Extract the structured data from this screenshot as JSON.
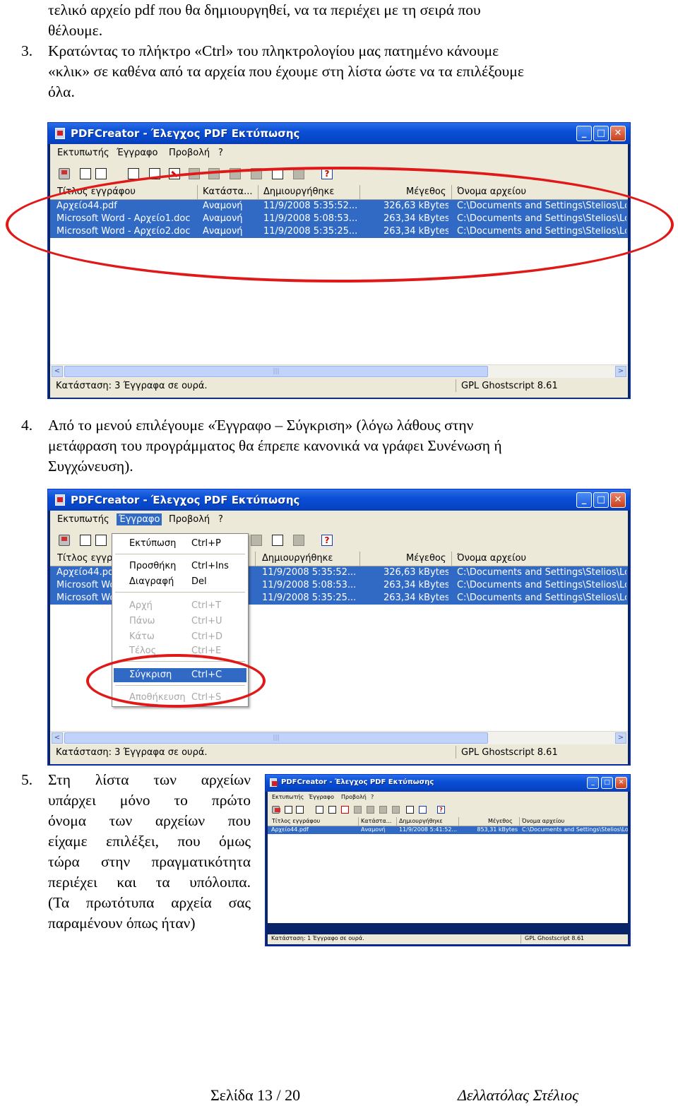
{
  "paragraphs": {
    "top_1": "τελικό αρχείο pdf που θα δημιουργηθεί, να τα περιέχει με τη σειρά που",
    "top_2": "θέλουμε.",
    "step3_num": "3.",
    "step3_1": "Κρατώντας το πλήκτρο «Ctrl» του πληκτρολογίου μας πατημένο κάνουμε",
    "step3_2": "«κλικ» σε καθένα από τα αρχεία που έχουμε στη λίστα ώστε να τα επιλέξουμε",
    "step3_3": "όλα.",
    "step4_num": "4.",
    "step4_1": "Από το μενού επιλέγουμε «Έγγραφο – Σύγκριση» (λόγω λάθους στην",
    "step4_2": "μετάφραση του προγράμματος θα έπρεπε κανονικά να γράφει Συνένωση ή",
    "step4_3": "Συγχώνευση).",
    "step5_num": "5.",
    "step5_lines": [
      "Στη λίστα των αρχείων",
      "υπάρχει μόνο το πρώτο",
      "όνομα των αρχείων που",
      "είχαμε επιλέξει, που όμως",
      "τώρα στην πραγματικότητα",
      "περιέχει και τα υπόλοιπα.",
      "(Τα πρωτότυπα αρχεία σας",
      "παραμένουν όπως ήταν)"
    ]
  },
  "window": {
    "title": "PDFCreator - Έλεγχος PDF Εκτύπωσης",
    "minimize_symbol": "_",
    "maximize_symbol": "□",
    "close_symbol": "✕",
    "menu": [
      "Εκτυπωτής",
      "Έγγραφο",
      "Προβολή",
      "?"
    ],
    "columns": [
      "Τίτλος εγγράφου",
      "Κατάστα...",
      "Δημιουργήθηκε",
      "Μέγεθος",
      "Όνομα αρχείου"
    ],
    "scroll_left": "<",
    "scroll_right": ">",
    "scroll_grip": "|||",
    "help_symbol": "?"
  },
  "screenshot1": {
    "rows": [
      [
        "Αρχείο44.pdf",
        "Αναμονή",
        "11/9/2008 5:35:52...",
        "326,63 kBytes",
        "C:\\Documents and Settings\\Stelios\\Loc"
      ],
      [
        "Microsoft Word - Αρχείο1.doc",
        "Αναμονή",
        "11/9/2008 5:08:53...",
        "263,34 kBytes",
        "C:\\Documents and Settings\\Stelios\\Loc"
      ],
      [
        "Microsoft Word - Αρχείο2.doc",
        "Αναμονή",
        "11/9/2008 5:35:25...",
        "263,34 kBytes",
        "C:\\Documents and Settings\\Stelios\\Loc"
      ]
    ],
    "status_left": "Κατάσταση: 3 Έγγραφα σε ουρά.",
    "status_right": "GPL Ghostscript 8.61"
  },
  "screenshot2": {
    "rows": [
      [
        "Αρχείο44.pd",
        "11/9/2008 5:35:52...",
        "326,63 kBytes",
        "C:\\Documents and Settings\\Stelios\\Loc"
      ],
      [
        "Microsoft Wo",
        "11/9/2008 5:08:53...",
        "263,34 kBytes",
        "C:\\Documents and Settings\\Stelios\\Loc"
      ],
      [
        "Microsoft Wo",
        "11/9/2008 5:35:25...",
        "263,34 kBytes",
        "C:\\Documents and Settings\\Stelios\\Loc"
      ]
    ],
    "col_title_truncated": "Τίτλος εγγρ",
    "menu_items": [
      {
        "label": "Εκτύπωση",
        "shortcut": "Ctrl+P"
      },
      {
        "label": "Προσθήκη",
        "shortcut": "Ctrl+Ins"
      },
      {
        "label": "Διαγραφή",
        "shortcut": "Del"
      },
      {
        "label": "Αρχή",
        "shortcut": "Ctrl+T"
      },
      {
        "label": "Πάνω",
        "shortcut": "Ctrl+U"
      },
      {
        "label": "Κάτω",
        "shortcut": "Ctrl+D"
      },
      {
        "label": "Τέλος",
        "shortcut": "Ctrl+E"
      },
      {
        "label": "Σύγκριση",
        "shortcut": "Ctrl+C"
      },
      {
        "label": "Αποθήκευση",
        "shortcut": "Ctrl+S"
      }
    ],
    "status_left": "Κατάσταση: 3 Έγγραφα σε ουρά.",
    "status_right": "GPL Ghostscript 8.61"
  },
  "screenshot3": {
    "row": [
      "Αρχείο44.pdf",
      "Αναμονή",
      "11/9/2008 5:41:52...",
      "853,31 kBytes",
      "C:\\Documents and Settings\\Stelios\\Loc"
    ],
    "status_left": "Κατάσταση: 1 Έγγραφο σε ουρά.",
    "status_right": "GPL Ghostscript 8.61"
  },
  "footer": {
    "page": "Σελίδα 13 / 20",
    "author": "Δελλατόλας Στέλιος"
  },
  "colors": {
    "selection": "#316ac5",
    "annotation": "#e01818",
    "chrome": "#ece9d8"
  }
}
